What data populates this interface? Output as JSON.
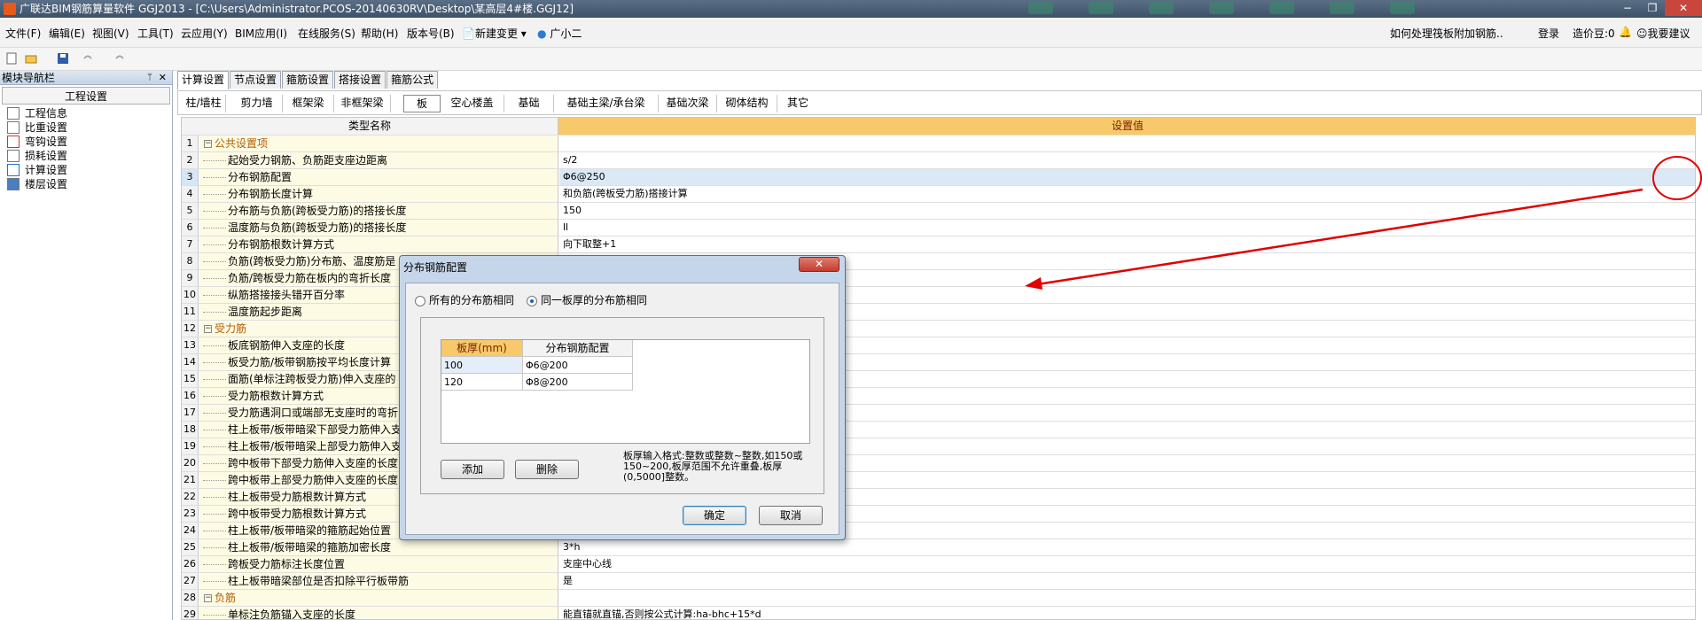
{
  "titlebar": {
    "title": "广联达BIM钢筋算量软件 GGJ2013 - [C:\\Users\\Administrator.PCOS-20140630RV\\Desktop\\某高层4#楼.GGJ12]",
    "minimize": "−",
    "restore": "❐",
    "close": "✕"
  },
  "menu": {
    "items": [
      "文件(F)",
      "编辑(E)",
      "视图(V)",
      "工具(T)",
      "云应用(Y)",
      "BIM应用(I)",
      "在线服务(S)",
      "帮助(H)",
      "版本号(B)",
      "新建变更",
      "广小二"
    ],
    "help_question": "如何处理筏板附加钢筋..",
    "login": "登录",
    "beans": "造价豆:0",
    "suggest": "我要建议"
  },
  "nav": {
    "header": "模块导航栏",
    "pin": "ᛘ",
    "close": "✕",
    "section": "工程设置",
    "items": [
      "工程信息",
      "比重设置",
      "弯钩设置",
      "损耗设置",
      "计算设置",
      "楼层设置"
    ]
  },
  "tabs": [
    "计算设置",
    "节点设置",
    "箍筋设置",
    "搭接设置",
    "箍筋公式"
  ],
  "subtabs": [
    "柱/墙柱",
    "剪力墙",
    "框架梁",
    "非框架梁",
    "板",
    "空心楼盖",
    "基础",
    "基础主梁/承台梁",
    "基础次梁",
    "砌体结构",
    "其它"
  ],
  "grid": {
    "col_name": "类型名称",
    "col_value": "设置值",
    "rows": [
      {
        "n": "1",
        "name": "公共设置项",
        "val": "",
        "grp": true
      },
      {
        "n": "2",
        "name": "起始受力钢筋、负筋距支座边距离",
        "val": "s/2"
      },
      {
        "n": "3",
        "name": "分布钢筋配置",
        "val": "Φ6@250"
      },
      {
        "n": "4",
        "name": "分布钢筋长度计算",
        "val": "和负筋(跨板受力筋)搭接计算"
      },
      {
        "n": "5",
        "name": "分布筋与负筋(跨板受力筋)的搭接长度",
        "val": "150"
      },
      {
        "n": "6",
        "name": "温度筋与负筋(跨板受力筋)的搭接长度",
        "val": "ll"
      },
      {
        "n": "7",
        "name": "分布钢筋根数计算方式",
        "val": "向下取整+1"
      },
      {
        "n": "8",
        "name": "负筋(跨板受力筋)分布筋、温度筋是",
        "val": ""
      },
      {
        "n": "9",
        "name": "负筋/跨板受力筋在板内的弯折长度",
        "val": ""
      },
      {
        "n": "10",
        "name": "纵筋搭接接头错开百分率",
        "val": ""
      },
      {
        "n": "11",
        "name": "温度筋起步距离",
        "val": ""
      },
      {
        "n": "12",
        "name": "受力筋",
        "val": "",
        "grp": true
      },
      {
        "n": "13",
        "name": "板底钢筋伸入支座的长度",
        "val": ""
      },
      {
        "n": "14",
        "name": "板受力筋/板带钢筋按平均长度计算",
        "val": ""
      },
      {
        "n": "15",
        "name": "面筋(单标注跨板受力筋)伸入支座的",
        "val": ""
      },
      {
        "n": "16",
        "name": "受力筋根数计算方式",
        "val": ""
      },
      {
        "n": "17",
        "name": "受力筋遇洞口或端部无支座时的弯折",
        "val": ""
      },
      {
        "n": "18",
        "name": "柱上板带/板带暗梁下部受力筋伸入支",
        "val": ""
      },
      {
        "n": "19",
        "name": "柱上板带/板带暗梁上部受力筋伸入支",
        "val": ""
      },
      {
        "n": "20",
        "name": "跨中板带下部受力筋伸入支座的长度",
        "val": ""
      },
      {
        "n": "21",
        "name": "跨中板带上部受力筋伸入支座的长度",
        "val": ""
      },
      {
        "n": "22",
        "name": "柱上板带受力筋根数计算方式",
        "val": ""
      },
      {
        "n": "23",
        "name": "跨中板带受力筋根数计算方式",
        "val": ""
      },
      {
        "n": "24",
        "name": "柱上板带/板带暗梁的箍筋起始位置",
        "val": ""
      },
      {
        "n": "25",
        "name": "柱上板带/板带暗梁的箍筋加密长度",
        "val": "3*h"
      },
      {
        "n": "26",
        "name": "跨板受力筋标注长度位置",
        "val": "支座中心线"
      },
      {
        "n": "27",
        "name": "柱上板带暗梁部位是否扣除平行板带筋",
        "val": "是"
      },
      {
        "n": "28",
        "name": "负筋",
        "val": "",
        "grp": true
      },
      {
        "n": "29",
        "name": "单标注负筋锚入支座的长度",
        "val": "能直锚就直锚,否则按公式计算:ha-bhc+15*d"
      }
    ]
  },
  "dialog": {
    "title": "分布钢筋配置",
    "close": "✕",
    "radio_all": "所有的分布筋相同",
    "radio_same": "同一板厚的分布筋相同",
    "col_thick": "板厚(mm)",
    "col_config": "分布钢筋配置",
    "rows": [
      {
        "thick": "100",
        "config": "Φ6@200"
      },
      {
        "thick": "120",
        "config": "Φ8@200"
      }
    ],
    "add": "添加",
    "delete": "删除",
    "hint": "板厚输入格式:整数或整数~整数,如150或150~200,板厚范围不允许重叠,板厚(0,5000]整数。",
    "ok": "确定",
    "cancel": "取消"
  },
  "colors": {
    "annotation": "#e00000",
    "accent_header": "#f7c96a"
  }
}
